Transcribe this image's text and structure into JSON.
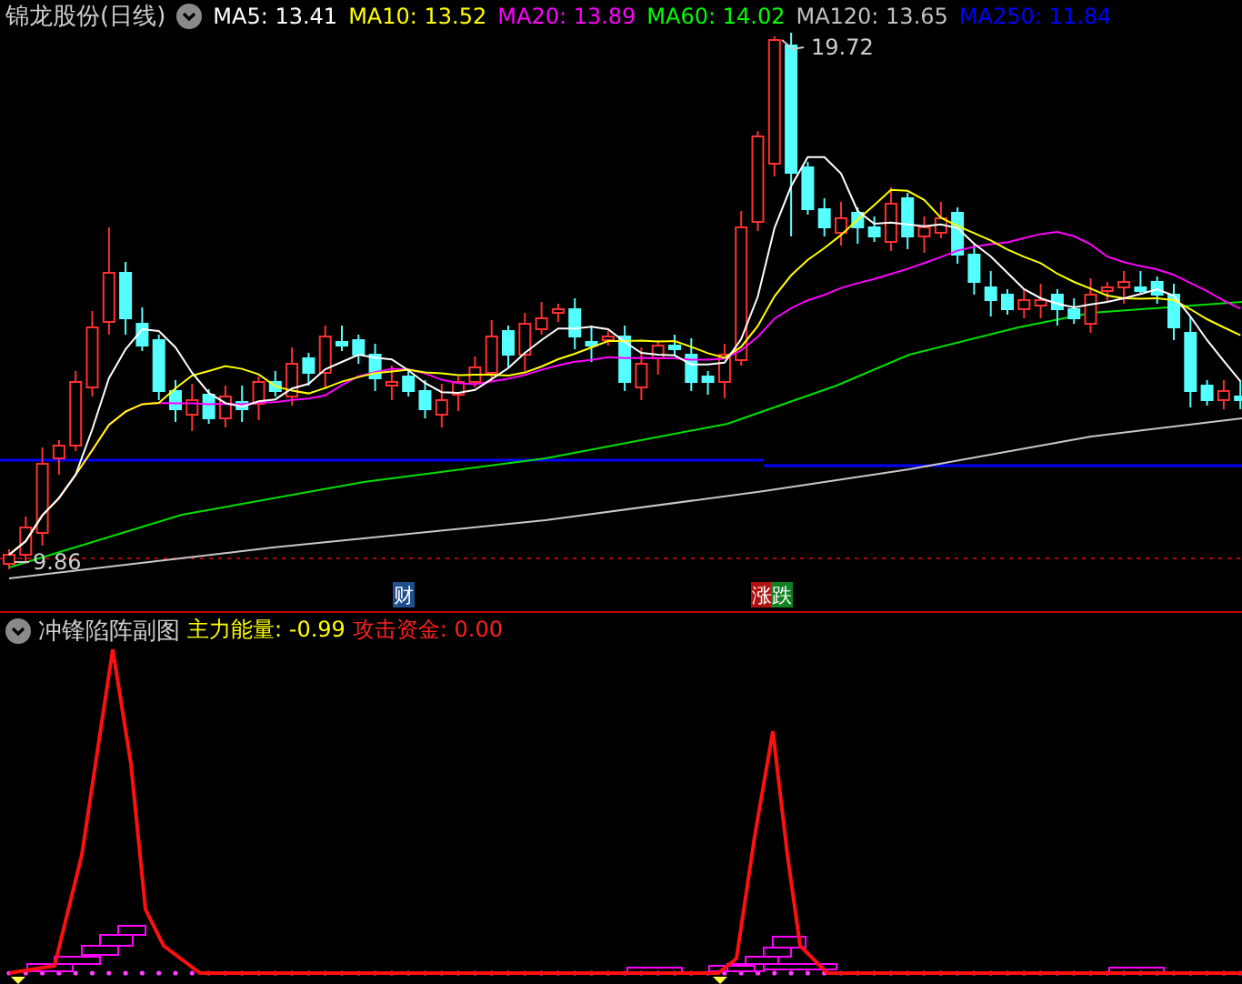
{
  "header": {
    "title": "锦龙股份(日线)",
    "legend": [
      {
        "text": "MA5: 13.41",
        "color": "#ffffff"
      },
      {
        "text": "MA10: 13.52",
        "color": "#ffff00"
      },
      {
        "text": "MA20: 13.89",
        "color": "#ff00ff"
      },
      {
        "text": "MA60: 14.02",
        "color": "#00ff00"
      },
      {
        "text": "MA120: 13.65",
        "color": "#c0c0c0"
      },
      {
        "text": "MA250: 11.84",
        "color": "#0000ff"
      }
    ]
  },
  "price_chart": {
    "high_label": "19.72",
    "low_label": "9.86"
  },
  "markers": [
    {
      "text": "财",
      "color": "#1f4e8c"
    },
    {
      "text": "涨",
      "color": "#b01010"
    },
    {
      "text": "跌",
      "color": "#108020"
    }
  ],
  "sub_chart": {
    "title": "冲锋陷阵副图",
    "indicators": [
      {
        "text": "主力能量: -0.99",
        "color": "#ffff00"
      },
      {
        "text": "攻击资金: 0.00",
        "color": "#ff2020"
      }
    ]
  }
}
